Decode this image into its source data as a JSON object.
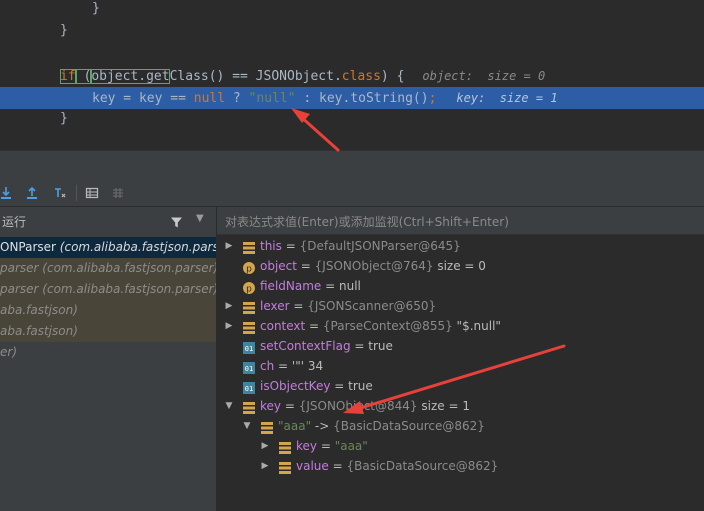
{
  "editor": {
    "line1": "}",
    "line2": "}",
    "line4": {
      "if_kw": "if",
      "paren_open": " (",
      "boxed": "object.get",
      "rest": "Class() == JSONObject.",
      "class_kw": "class",
      "tail": ") {",
      "hint": "object:  size = 0"
    },
    "line5": {
      "text1": "key = key == ",
      "null_kw": "null",
      "text2": " ? ",
      "str": "\"null\"",
      "text3": " : key.toString()",
      "semi": ";",
      "hint": "key:  size = 1"
    },
    "line6": "}"
  },
  "toolbar": {
    "icons": [
      "step-into-icon",
      "step-out-icon",
      "run-to-cursor-icon",
      "evaluate-table-icon",
      "grid-icon"
    ]
  },
  "frames": {
    "title": "运行",
    "items": [
      {
        "method": "ONParser",
        "loc": " (com.alibaba.fastjson.parser",
        "style": "selected"
      },
      {
        "method": "parser",
        "loc": " (com.alibaba.fastjson.parser)",
        "style": "lib"
      },
      {
        "method": "parser",
        "loc": " (com.alibaba.fastjson.parser)",
        "style": "lib"
      },
      {
        "method": "",
        "loc": "aba.fastjson)",
        "style": "lib"
      },
      {
        "method": "",
        "loc": "aba.fastjson)",
        "style": "lib"
      },
      {
        "method": "",
        "loc": "er)",
        "style": "plain"
      }
    ]
  },
  "variables": {
    "watch_placeholder": "对表达式求值(Enter)或添加监视(Ctrl+Shift+Enter)",
    "rows": [
      {
        "name": "this",
        "eq": " = ",
        "cls": "{DefaultJSONParser@645}",
        "extra": ""
      },
      {
        "name": "object",
        "eq": " = ",
        "cls": "{JSONObject@764}",
        "extra": "  size = 0"
      },
      {
        "name": "fieldName",
        "eq": " = ",
        "cls": "",
        "extra": "null"
      },
      {
        "name": "lexer",
        "eq": " = ",
        "cls": "{JSONScanner@650}",
        "extra": ""
      },
      {
        "name": "context",
        "eq": " = ",
        "cls": "{ParseContext@855}",
        "extra": " \"$.null\""
      },
      {
        "name": "setContextFlag",
        "eq": " = ",
        "cls": "",
        "extra": "true"
      },
      {
        "name": "ch",
        "eq": " = ",
        "cls": "",
        "extra": "'\"' 34"
      },
      {
        "name": "isObjectKey",
        "eq": " = ",
        "cls": "",
        "extra": "true"
      },
      {
        "name": "key",
        "eq": " = ",
        "cls": "{JSONObject@844}",
        "extra": "  size = 1"
      },
      {
        "name": "\"aaa\"",
        "eq": " -> ",
        "cls": "{BasicDataSource@862}",
        "extra": ""
      },
      {
        "name": "key",
        "eq": " = ",
        "cls": "",
        "extra": "\"aaa\""
      },
      {
        "name": "value",
        "eq": " = ",
        "cls": "{BasicDataSource@862}",
        "extra": ""
      }
    ]
  },
  "colors": {
    "accent_arrow": "#e8413a",
    "selection": "#2d5ea5"
  }
}
